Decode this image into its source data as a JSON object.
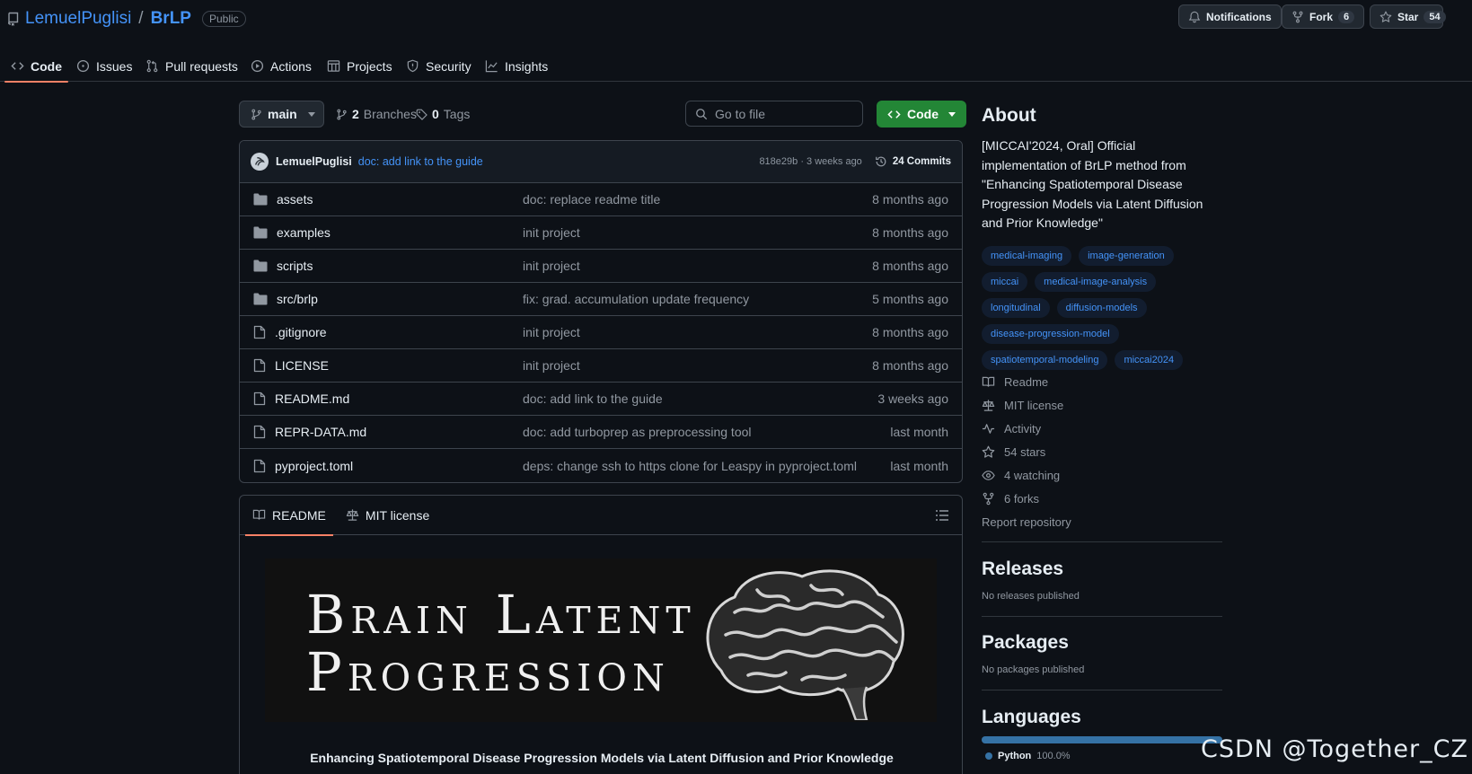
{
  "repo": {
    "owner": "LemuelPuglisi",
    "separator": "/",
    "name": "BrLP",
    "visibility": "Public"
  },
  "header_buttons": {
    "notifications": "Notifications",
    "fork_label": "Fork",
    "fork_count": "6",
    "star_label": "Star",
    "star_count": "54"
  },
  "tabs": [
    {
      "label": "Code",
      "icon": "code-icon"
    },
    {
      "label": "Issues",
      "icon": "issue-icon"
    },
    {
      "label": "Pull requests",
      "icon": "pull-request-icon"
    },
    {
      "label": "Actions",
      "icon": "play-icon"
    },
    {
      "label": "Projects",
      "icon": "table-icon"
    },
    {
      "label": "Security",
      "icon": "shield-icon"
    },
    {
      "label": "Insights",
      "icon": "graph-icon"
    }
  ],
  "toolbar": {
    "branch": "main",
    "branches_count": "2",
    "branches_label": "Branches",
    "tags_count": "0",
    "tags_label": "Tags",
    "search_placeholder": "Go to file",
    "code_button": "Code"
  },
  "latest_commit": {
    "author": "LemuelPuglisi",
    "message": "doc: add link to the guide",
    "hash_time": "818e29b · 3 weeks ago",
    "commits": "24 Commits"
  },
  "files": [
    {
      "type": "folder",
      "name": "assets",
      "message": "doc: replace readme title",
      "date": "8 months ago"
    },
    {
      "type": "folder",
      "name": "examples",
      "message": "init project",
      "date": "8 months ago"
    },
    {
      "type": "folder",
      "name": "scripts",
      "message": "init project",
      "date": "8 months ago"
    },
    {
      "type": "folder",
      "name": "src/brlp",
      "message": "fix: grad. accumulation update frequency",
      "date": "5 months ago"
    },
    {
      "type": "file",
      "name": ".gitignore",
      "message": "init project",
      "date": "8 months ago"
    },
    {
      "type": "file",
      "name": "LICENSE",
      "message": "init project",
      "date": "8 months ago"
    },
    {
      "type": "file",
      "name": "README.md",
      "message": "doc: add link to the guide",
      "date": "3 weeks ago"
    },
    {
      "type": "file",
      "name": "REPR-DATA.md",
      "message": "doc: add turboprep as preprocessing tool",
      "date": "last month"
    },
    {
      "type": "file",
      "name": "pyproject.toml",
      "message": "deps: change ssh to https clone for Leaspy in pyproject.toml",
      "date": "last month"
    }
  ],
  "readme": {
    "tab_readme": "README",
    "tab_license": "MIT license",
    "banner_line1": "Brain Latent",
    "banner_line2": "Progression",
    "subtitle": "Enhancing Spatiotemporal Disease Progression Models via Latent Diffusion and Prior Knowledge"
  },
  "about": {
    "heading": "About",
    "description": "[MICCAI'2024, Oral] Official implementation of BrLP method from \"Enhancing Spatiotemporal Disease Progression Models via Latent Diffusion and Prior Knowledge\"",
    "topics": [
      "medical-imaging",
      "image-generation",
      "miccai",
      "medical-image-analysis",
      "longitudinal",
      "diffusion-models",
      "disease-progression-model",
      "spatiotemporal-modeling",
      "miccai2024"
    ],
    "readme": "Readme",
    "license": "MIT license",
    "activity": "Activity",
    "stars": "54 stars",
    "watching": "4 watching",
    "forks": "6 forks",
    "report": "Report repository"
  },
  "releases": {
    "heading": "Releases",
    "text": "No releases published"
  },
  "packages": {
    "heading": "Packages",
    "text": "No packages published"
  },
  "languages": {
    "heading": "Languages",
    "items": [
      {
        "name": "Python",
        "percent": "100.0%",
        "fraction": 1.0,
        "color": "#3572a5"
      }
    ]
  },
  "watermark": "CSDN @Together_CZ"
}
